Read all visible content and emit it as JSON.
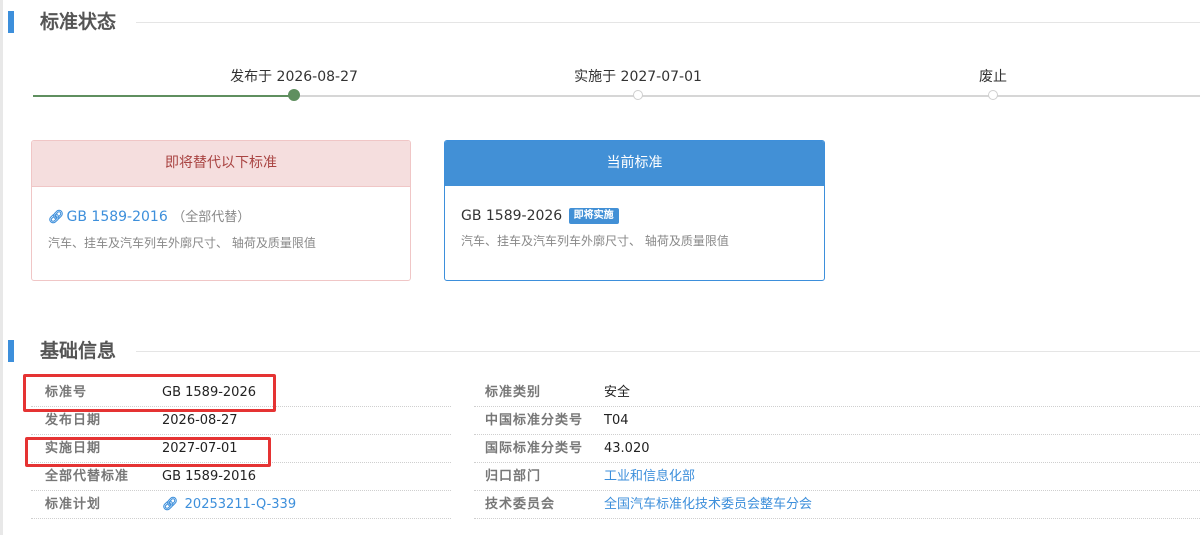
{
  "status_section": {
    "title": "标准状态"
  },
  "timeline": {
    "steps": [
      {
        "label": "发布于 2026-08-27",
        "state": "done"
      },
      {
        "label": "实施于 2027-07-01",
        "state": "pending"
      },
      {
        "label": "废止",
        "state": "pending"
      }
    ],
    "done_color": "#5f8f5f",
    "pending_color": "#d6d6d6"
  },
  "replace_card": {
    "header": "即将替代以下标准",
    "standard_code": "GB 1589-2016",
    "note": "（全部代替）",
    "description": "汽车、挂车及汽车列车外廓尺寸、 轴荷及质量限值"
  },
  "current_card": {
    "header": "当前标准",
    "standard_code": "GB 1589-2026",
    "badge": "即将实施",
    "description": "汽车、挂车及汽车列车外廓尺寸、 轴荷及质量限值"
  },
  "basic_section": {
    "title": "基础信息"
  },
  "info_rows": [
    {
      "left_label": "标准号",
      "left_value": "GB 1589-2026",
      "right_label": "标准类别",
      "right_value": "安全"
    },
    {
      "left_label": "发布日期",
      "left_value": "2026-08-27",
      "right_label": "中国标准分类号",
      "right_value": "T04"
    },
    {
      "left_label": "实施日期",
      "left_value": "2027-07-01",
      "right_label": "国际标准分类号",
      "right_value": "43.020"
    },
    {
      "left_label": "全部代替标准",
      "left_value": "GB 1589-2016",
      "right_label": "归口部门",
      "right_value": "工业和信息化部"
    },
    {
      "left_label": "标准计划",
      "left_value": "20253211-Q-339",
      "right_label": "技术委员会",
      "right_value": "全国汽车标准化技术委员会整车分会"
    }
  ],
  "colors": {
    "accent": "#3d8fdb",
    "highlight_border": "#e53333"
  }
}
